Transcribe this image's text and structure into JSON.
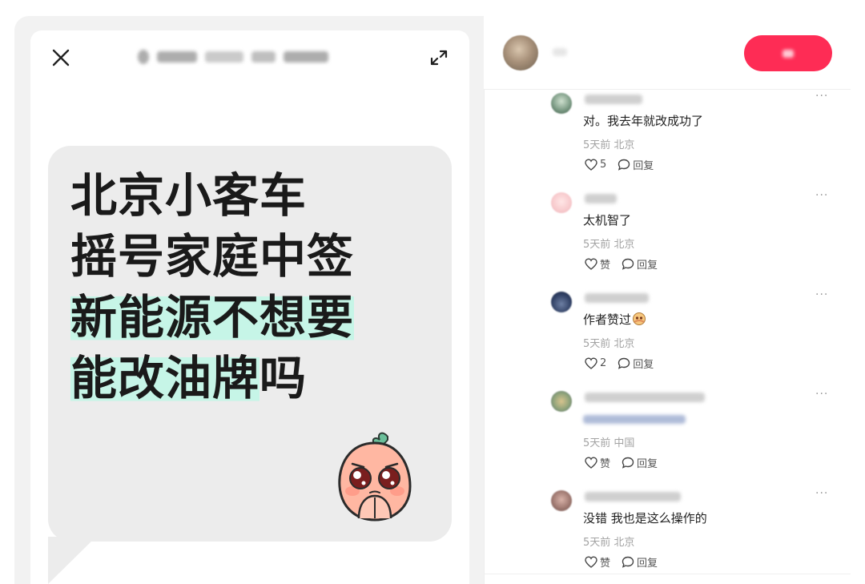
{
  "post": {
    "headline_lines": [
      {
        "text": "北京小客车",
        "highlight": ""
      },
      {
        "text": "摇号家庭中签",
        "highlight": ""
      },
      {
        "text": "",
        "highlight": "新能源不想要"
      },
      {
        "text": "吗",
        "highlight": "能改油牌"
      }
    ],
    "highlight_color": "#c6f5e7",
    "close_icon": "close-icon",
    "expand_icon": "expand-icon",
    "sticker_icon": "pleading-peach-sticker"
  },
  "header": {
    "follow_color": "#fe2c55"
  },
  "comments": [
    {
      "text": "对。我去年就改成功了",
      "time": "5天前",
      "location": "北京",
      "likes": "5",
      "reply": "回复"
    },
    {
      "text": "太机智了",
      "time": "5天前",
      "location": "北京",
      "likes": "赞",
      "reply": "回复"
    },
    {
      "text": "作者赞过",
      "time": "5天前",
      "location": "北京",
      "likes": "2",
      "reply": "回复"
    },
    {
      "text": "",
      "time": "5天前",
      "location": "中国",
      "likes": "赞",
      "reply": "回复"
    },
    {
      "text": "没错 我也是这么操作的",
      "time": "5天前",
      "location": "北京",
      "likes": "赞",
      "reply": "回复"
    }
  ],
  "more_label": "···"
}
